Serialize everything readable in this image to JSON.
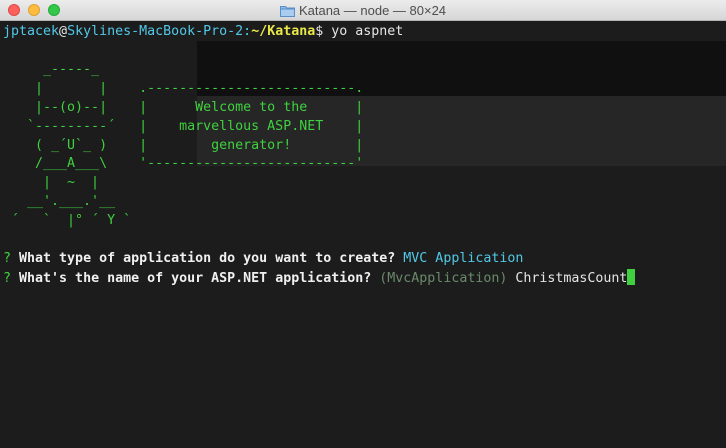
{
  "window": {
    "title": "Katana — node — 80×24",
    "folder_icon": "folder-icon"
  },
  "prompt": {
    "user": "jptacek",
    "at": "@",
    "host": "Skylines-MacBook-Pro-2:",
    "path": "~/Katana",
    "symbol": "$",
    "command": " yo aspnet"
  },
  "ascii_art": [
    "     _-----_",
    "    |       |    .--------------------------.",
    "    |--(o)--|    |      Welcome to the      |",
    "   `---------´   |    marvellous ASP.NET    |",
    "    ( _´U`_ )    |        generator!        |",
    "    /___A___\\    '--------------------------'",
    "     |  ~  |",
    "   __'.___.'__",
    " ´   `  |° ´ Y `"
  ],
  "questions": [
    {
      "marker": "?",
      "text": " What type of application do you want to create?",
      "answer": " MVC Application"
    },
    {
      "marker": "?",
      "text": " What's the name of your ASP.NET application?",
      "default": " (MvcApplication)",
      "answer": " ChristmasCount"
    }
  ],
  "colors": {
    "terminal_bg": "#1c1c1c",
    "green": "#3fd13f",
    "cyan": "#52c7e6",
    "yellow": "#e8e84a"
  }
}
